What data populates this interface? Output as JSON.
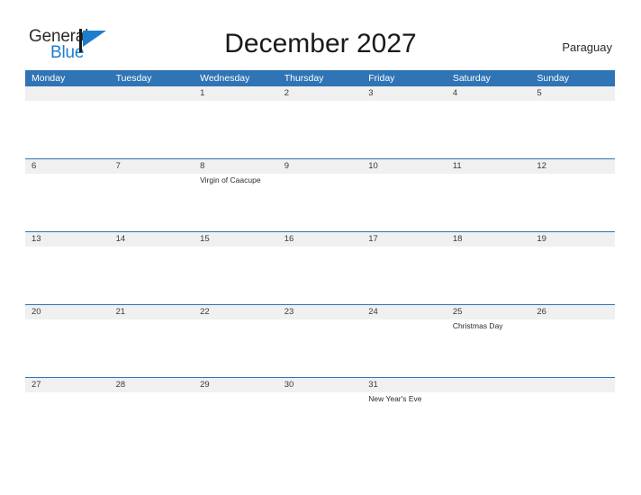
{
  "brand": {
    "name_part1": "General",
    "name_part2": "Blue",
    "flag_icon": "flag-triangle-icon",
    "accent_color": "#1d7dd1"
  },
  "header": {
    "title": "December 2027",
    "country": "Paraguay"
  },
  "calendar": {
    "month": "December",
    "year": "2027",
    "header_bg_color": "#2f74b5",
    "date_band_color": "#f0f0f0",
    "rule_color": "#2f74b5",
    "day_headers": [
      "Monday",
      "Tuesday",
      "Wednesday",
      "Thursday",
      "Friday",
      "Saturday",
      "Sunday"
    ],
    "weeks": [
      {
        "dates": [
          "",
          "",
          "1",
          "2",
          "3",
          "4",
          "5"
        ],
        "events": [
          "",
          "",
          "",
          "",
          "",
          "",
          ""
        ]
      },
      {
        "dates": [
          "6",
          "7",
          "8",
          "9",
          "10",
          "11",
          "12"
        ],
        "events": [
          "",
          "",
          "Virgin of Caacupe",
          "",
          "",
          "",
          ""
        ]
      },
      {
        "dates": [
          "13",
          "14",
          "15",
          "16",
          "17",
          "18",
          "19"
        ],
        "events": [
          "",
          "",
          "",
          "",
          "",
          "",
          ""
        ]
      },
      {
        "dates": [
          "20",
          "21",
          "22",
          "23",
          "24",
          "25",
          "26"
        ],
        "events": [
          "",
          "",
          "",
          "",
          "",
          "Christmas Day",
          ""
        ]
      },
      {
        "dates": [
          "27",
          "28",
          "29",
          "30",
          "31",
          "",
          ""
        ],
        "events": [
          "",
          "",
          "",
          "",
          "New Year's Eve",
          "",
          ""
        ]
      }
    ]
  }
}
